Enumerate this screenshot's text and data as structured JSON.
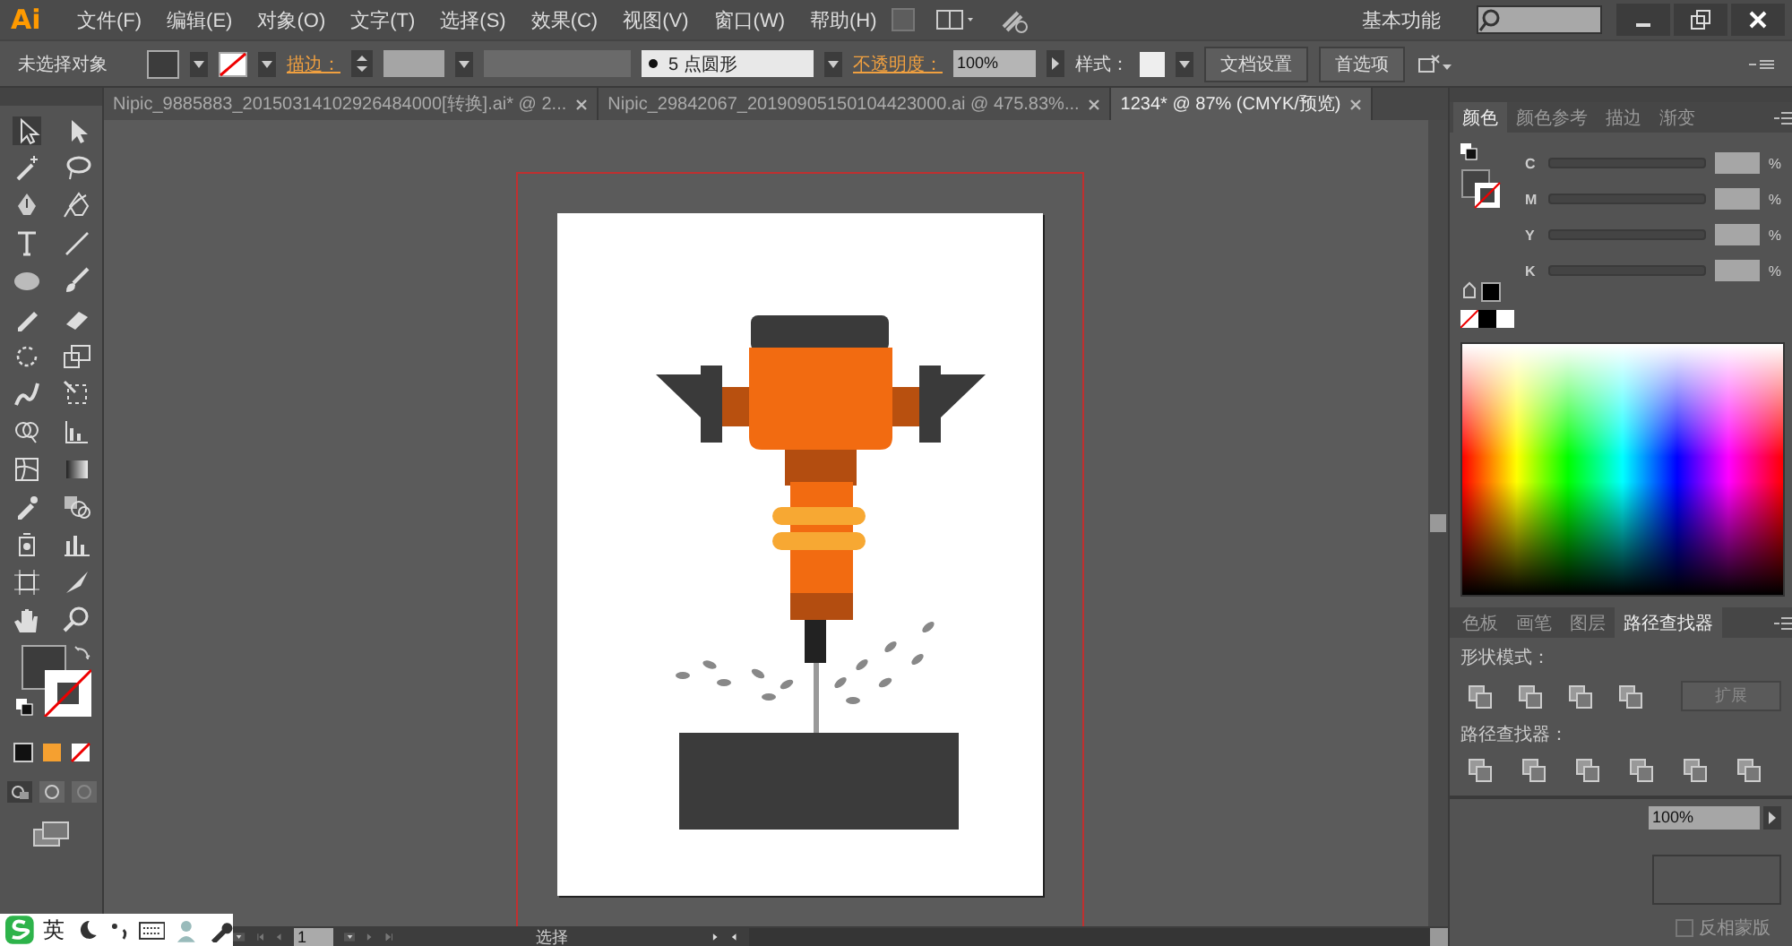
{
  "app_logo": "Ai",
  "menu": [
    "文件(F)",
    "编辑(E)",
    "对象(O)",
    "文字(T)",
    "选择(S)",
    "效果(C)",
    "视图(V)",
    "窗口(W)",
    "帮助(H)"
  ],
  "workspace": "基本功能",
  "control_bar": {
    "selection": "未选择对象",
    "stroke_label": "描边：",
    "brush": "5 点圆形",
    "opacity_label": "不透明度：",
    "opacity": "100%",
    "style_label": "样式：",
    "buttons": [
      "文档设置",
      "首选项"
    ]
  },
  "tabs": [
    {
      "label": "Nipic_9885883_20150314102926484000[转换].ai* @ 2...",
      "selected": false
    },
    {
      "label": "Nipic_29842067_20190905150104423000.ai @ 475.83%...",
      "selected": false
    },
    {
      "label": "1234* @ 87% (CMYK/预览)",
      "selected": true
    }
  ],
  "color_panel": {
    "tabs": [
      {
        "label": "颜色",
        "selected": true
      },
      {
        "label": "颜色参考",
        "selected": false
      },
      {
        "label": "描边",
        "selected": false
      },
      {
        "label": "渐变",
        "selected": false
      }
    ],
    "channels": [
      {
        "name": "C",
        "unit": "%",
        "level": 0
      },
      {
        "name": "M",
        "unit": "%",
        "level": 0
      },
      {
        "name": "Y",
        "unit": "%",
        "level": 0
      },
      {
        "name": "K",
        "unit": "%",
        "level": 0
      }
    ]
  },
  "pathfinder_panel": {
    "tabs": [
      {
        "label": "色板",
        "selected": false
      },
      {
        "label": "画笔",
        "selected": false
      },
      {
        "label": "图层",
        "selected": false
      },
      {
        "label": "路径查找器",
        "selected": true
      }
    ],
    "shape_modes_label": "形状模式：",
    "expand_button": "扩展",
    "pathfinders_label": "路径查找器："
  },
  "transparency_panel": {
    "opacity": "100%",
    "invert_mask": {
      "label": "反相蒙版",
      "checked": false
    }
  },
  "status_bar": {
    "page": "1",
    "tool": "选择"
  },
  "ime_bar": {
    "language": "英"
  }
}
